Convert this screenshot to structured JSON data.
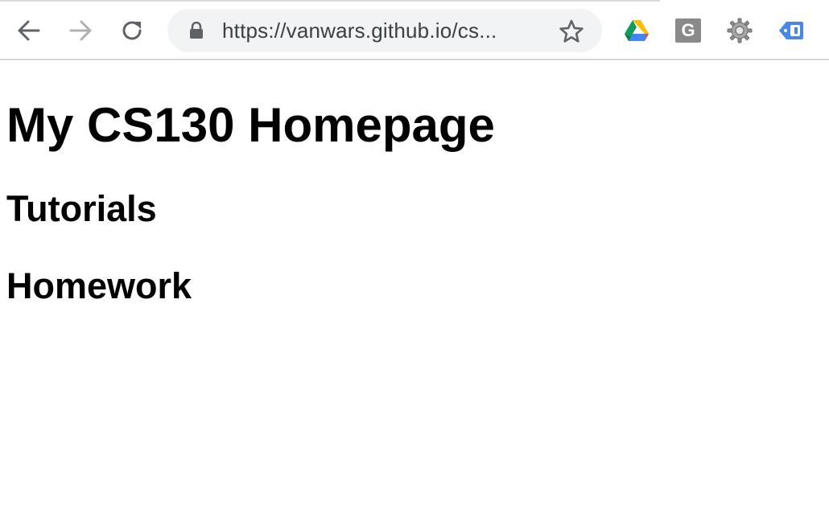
{
  "browser": {
    "url": "https://vanwars.github.io/cs...",
    "icons": {
      "back": "arrow-left-icon",
      "forward": "arrow-right-icon",
      "reload": "reload-icon",
      "secure": "lock-icon",
      "bookmark": "star-icon"
    },
    "extensions": [
      {
        "name": "google-drive-icon"
      },
      {
        "name": "g-extension-icon",
        "label": "G"
      },
      {
        "name": "gear-icon"
      },
      {
        "name": "tag-icon"
      }
    ]
  },
  "page": {
    "title": "My CS130 Homepage",
    "sections": [
      {
        "heading": "Tutorials"
      },
      {
        "heading": "Homework"
      }
    ]
  },
  "colors": {
    "omnibox_bg": "#f1f3f4",
    "text": "#000000",
    "url_text": "#3c4043",
    "icon_gray": "#5f6368",
    "forward_disabled": "#b0b0b0"
  }
}
